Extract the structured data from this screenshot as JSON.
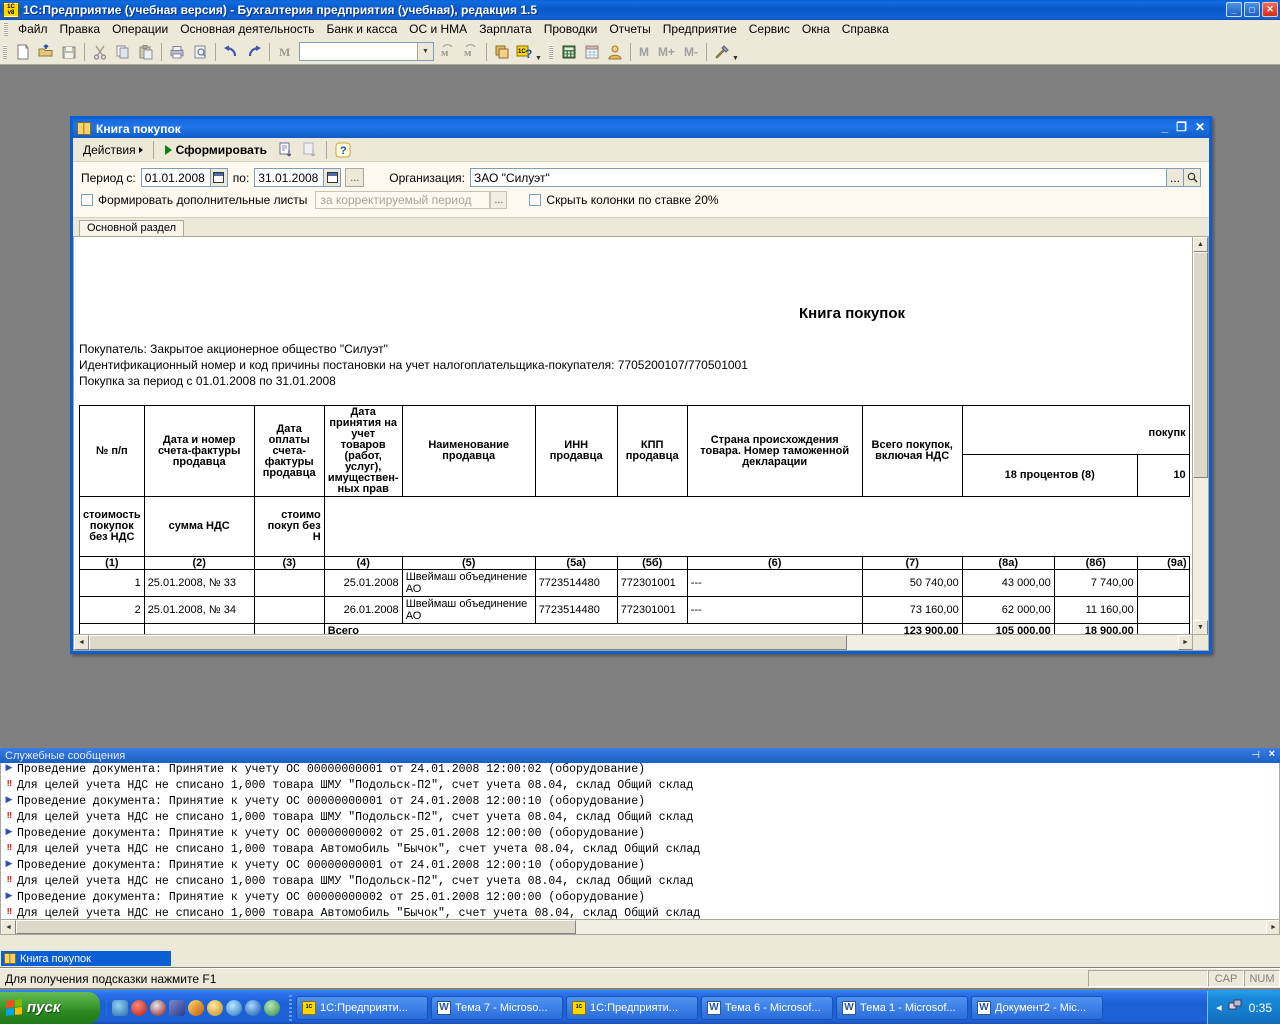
{
  "app": {
    "title": "1С:Предприятие (учебная версия) - Бухгалтерия предприятия (учебная), редакция 1.5",
    "icon": "1c-logo-icon",
    "minimize": "_",
    "maximize": "□",
    "close": "✕"
  },
  "menu": {
    "items": [
      {
        "label": "Файл"
      },
      {
        "label": "Правка"
      },
      {
        "label": "Операции"
      },
      {
        "label": "Основная деятельность"
      },
      {
        "label": "Банк и касса"
      },
      {
        "label": "ОС и НМА"
      },
      {
        "label": "Зарплата"
      },
      {
        "label": "Проводки"
      },
      {
        "label": "Отчеты"
      },
      {
        "label": "Предприятие"
      },
      {
        "label": "Сервис"
      },
      {
        "label": "Окна"
      },
      {
        "label": "Справка"
      }
    ]
  },
  "toolbar": {
    "search_value": "",
    "m_label": "M",
    "mplus_label": "M+",
    "mminus_label": "M-",
    "icons": [
      "new-document-icon",
      "open-folder-icon",
      "save-icon",
      "cut-scissors-icon",
      "copy-icon",
      "paste-icon",
      "print-icon",
      "print-preview-icon",
      "undo-icon",
      "redo-icon",
      "find-icon",
      "find-next-icon",
      "find-prev-icon",
      "copy-window-icon",
      "about-1c-icon",
      "calculator-icon",
      "calendar-icon",
      "user-icon",
      "settings-tools-icon"
    ]
  },
  "child_window": {
    "title": "Книга покупок",
    "icon": "book-icon",
    "minimize": "_",
    "maximize": "❐",
    "close": "✕",
    "toolbar": {
      "actions_label": "Действия",
      "generate_label": "Сформировать",
      "settings_icon": "report-settings-icon",
      "copy_icon": "copy-report-icon",
      "help_label": "?"
    },
    "params": {
      "period_from_label": "Период с:",
      "period_from_value": "01.01.2008",
      "period_to_label": "по:",
      "period_to_value": "31.01.2008",
      "period_more_label": "...",
      "org_label": "Организация:",
      "org_value": "ЗАО \"Силуэт\"",
      "org_select_label": "...",
      "org_find_icon": "magnifier-icon",
      "additional_sheets_label": "Формировать дополнительные листы",
      "additional_sheets_checked": false,
      "corrected_period_placeholder": "за корректируемый период",
      "corrected_period_more": "...",
      "hide_20_label": "Скрыть колонки по ставке 20%",
      "hide_20_checked": false
    },
    "tabs": [
      {
        "label": "Основной раздел",
        "active": true
      }
    ]
  },
  "report": {
    "title": "Книга покупок",
    "line1": "Покупатель:  Закрытое акционерное общество \"Силуэт\"",
    "line2": "Идентификационный номер и код причины постановки на учет налогоплательщика-покупателя:  7705200107/770501001",
    "line3": "Покупка за период с 01.01.2008 по 31.01.2008",
    "group_header_right": "покупк",
    "rate_group_18": "18 процентов (8)",
    "rate_group_10": "10",
    "headers": [
      "№ п/п",
      "Дата и номер счета-фактуры продавца",
      "Дата оплаты счета-фактуры продавца",
      "Дата принятия на учет товаров (работ, услуг), имуществен-ных прав",
      "Наименование продавца",
      "ИНН продавца",
      "КПП продавца",
      "Страна происхождения товара. Номер таможенной декларации",
      "Всего покупок, включая НДС",
      "стоимость покупок без НДС",
      "сумма НДС",
      "стоимо покуп без Н"
    ],
    "header_numbers": [
      "(1)",
      "(2)",
      "(3)",
      "(4)",
      "(5)",
      "(5а)",
      "(5б)",
      "(6)",
      "(7)",
      "(8а)",
      "(8б)",
      "(9а)"
    ],
    "rows": [
      {
        "num": "1",
        "invoice": "25.01.2008, № 33",
        "pay_date": "",
        "accept_date": "25.01.2008",
        "seller": "Швеймаш объединение АО",
        "inn": "7723514480",
        "kpp": "772301001",
        "country": "---",
        "total_with_vat": "50 740,00",
        "cost_18": "43 000,00",
        "vat_18": "7 740,00",
        "cost_10": ""
      },
      {
        "num": "2",
        "invoice": "25.01.2008, № 34",
        "pay_date": "",
        "accept_date": "26.01.2008",
        "seller": "Швеймаш объединение АО",
        "inn": "7723514480",
        "kpp": "772301001",
        "country": "---",
        "total_with_vat": "73 160,00",
        "cost_18": "62 000,00",
        "vat_18": "11 160,00",
        "cost_10": ""
      }
    ],
    "total": {
      "label": "Всего",
      "total_with_vat": "123 900,00",
      "cost_18": "105 000,00",
      "vat_18": "18 900,00",
      "cost_10": ""
    }
  },
  "service_messages": {
    "title": "Служебные сообщения",
    "pin_icon": "pin-icon",
    "close_icon": "close-icon",
    "messages": [
      {
        "type": "info",
        "text": "Проведение документа: Принятие к учету ОС 00000000001 от 24.01.2008 12:00:02 (оборудование)"
      },
      {
        "type": "warning",
        "text": "Для целей учета НДС не списано 1,000 товара ШМУ \"Подольск-П2\", счет учета 08.04, склад Общий склад"
      },
      {
        "type": "info",
        "text": "Проведение документа: Принятие к учету ОС 00000000001 от 24.01.2008 12:00:10 (оборудование)"
      },
      {
        "type": "warning",
        "text": "Для целей учета НДС не списано 1,000 товара ШМУ \"Подольск-П2\", счет учета 08.04, склад Общий склад"
      },
      {
        "type": "info",
        "text": "Проведение документа: Принятие к учету ОС 00000000002 от 25.01.2008 12:00:00 (оборудование)"
      },
      {
        "type": "warning",
        "text": "Для целей учета НДС не списано 1,000 товара Автомобиль \"Бычок\", счет учета 08.04, склад Общий склад"
      },
      {
        "type": "info",
        "text": "Проведение документа: Принятие к учету ОС 00000000001 от 24.01.2008 12:00:10 (оборудование)"
      },
      {
        "type": "warning",
        "text": "Для целей учета НДС не списано 1,000 товара ШМУ \"Подольск-П2\", счет учета 08.04, склад Общий склад"
      },
      {
        "type": "info",
        "text": "Проведение документа: Принятие к учету ОС 00000000002 от 25.01.2008 12:00:00 (оборудование)"
      },
      {
        "type": "warning",
        "text": "Для целей учета НДС не списано 1,000 товара Автомобиль \"Бычок\", счет учета 08.04, склад Общий склад"
      }
    ]
  },
  "window_list": [
    {
      "label": "Книга покупок",
      "icon": "book-icon",
      "active": true
    }
  ],
  "status_bar": {
    "hint": "Для получения подсказки нажмите F1",
    "caps": "CAP",
    "num": "NUM"
  },
  "taskbar": {
    "start_label": "пуск",
    "quick_launch": [
      "network-icon",
      "opera-icon",
      "winamp-icon",
      "explorer-icon",
      "flash-icon",
      "clock-icon",
      "ie-icon",
      "media-icon",
      "app-icon"
    ],
    "tasks": [
      {
        "label": "1С:Предприяти...",
        "icon": "1c-icon"
      },
      {
        "label": "Тема 7 - Microso...",
        "icon": "word-icon"
      },
      {
        "label": "1С:Предприяти...",
        "icon": "1c-icon"
      },
      {
        "label": "Тема 6 - Microsof...",
        "icon": "word-icon"
      },
      {
        "label": "Тема 1 - Microsof...",
        "icon": "word-icon"
      },
      {
        "label": "Документ2 - Mic...",
        "icon": "word-icon"
      }
    ],
    "tray": {
      "chevron": "‹",
      "network_icon": "network-tray-icon",
      "clock": "0:35"
    }
  },
  "colors": {
    "title_blue": "#0a5fd4",
    "face": "#ece9d8",
    "desktop": "#808080",
    "params_bg": "#fdf9ee",
    "msg_info": "#2a4fbf",
    "msg_warn": "#d01010"
  }
}
